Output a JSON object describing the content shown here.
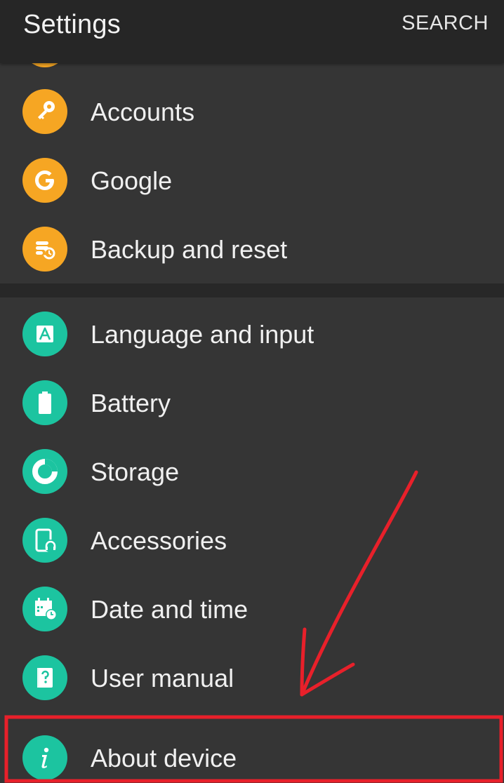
{
  "app_bar": {
    "title": "Settings",
    "action_label": "SEARCH"
  },
  "groups": [
    {
      "items": [
        {
          "label": "Accounts",
          "icon": "key-icon",
          "color": "#f6a623"
        },
        {
          "label": "Google",
          "icon": "google-g-icon",
          "color": "#f6a623"
        },
        {
          "label": "Backup and reset",
          "icon": "backup-restore-icon",
          "color": "#f6a623"
        }
      ]
    },
    {
      "items": [
        {
          "label": "Language and input",
          "icon": "language-a-icon",
          "color": "#1cc4a0"
        },
        {
          "label": "Battery",
          "icon": "battery-icon",
          "color": "#1cc4a0"
        },
        {
          "label": "Storage",
          "icon": "storage-pie-icon",
          "color": "#1cc4a0"
        },
        {
          "label": "Accessories",
          "icon": "accessories-headphone-icon",
          "color": "#1cc4a0"
        },
        {
          "label": "Date and time",
          "icon": "calendar-clock-icon",
          "color": "#1cc4a0"
        },
        {
          "label": "User manual",
          "icon": "help-book-icon",
          "color": "#1cc4a0"
        },
        {
          "label": "About device",
          "icon": "info-icon",
          "color": "#1cc4a0"
        }
      ]
    }
  ],
  "annotation": {
    "color": "#e8202a",
    "highlight_target": "About device"
  }
}
